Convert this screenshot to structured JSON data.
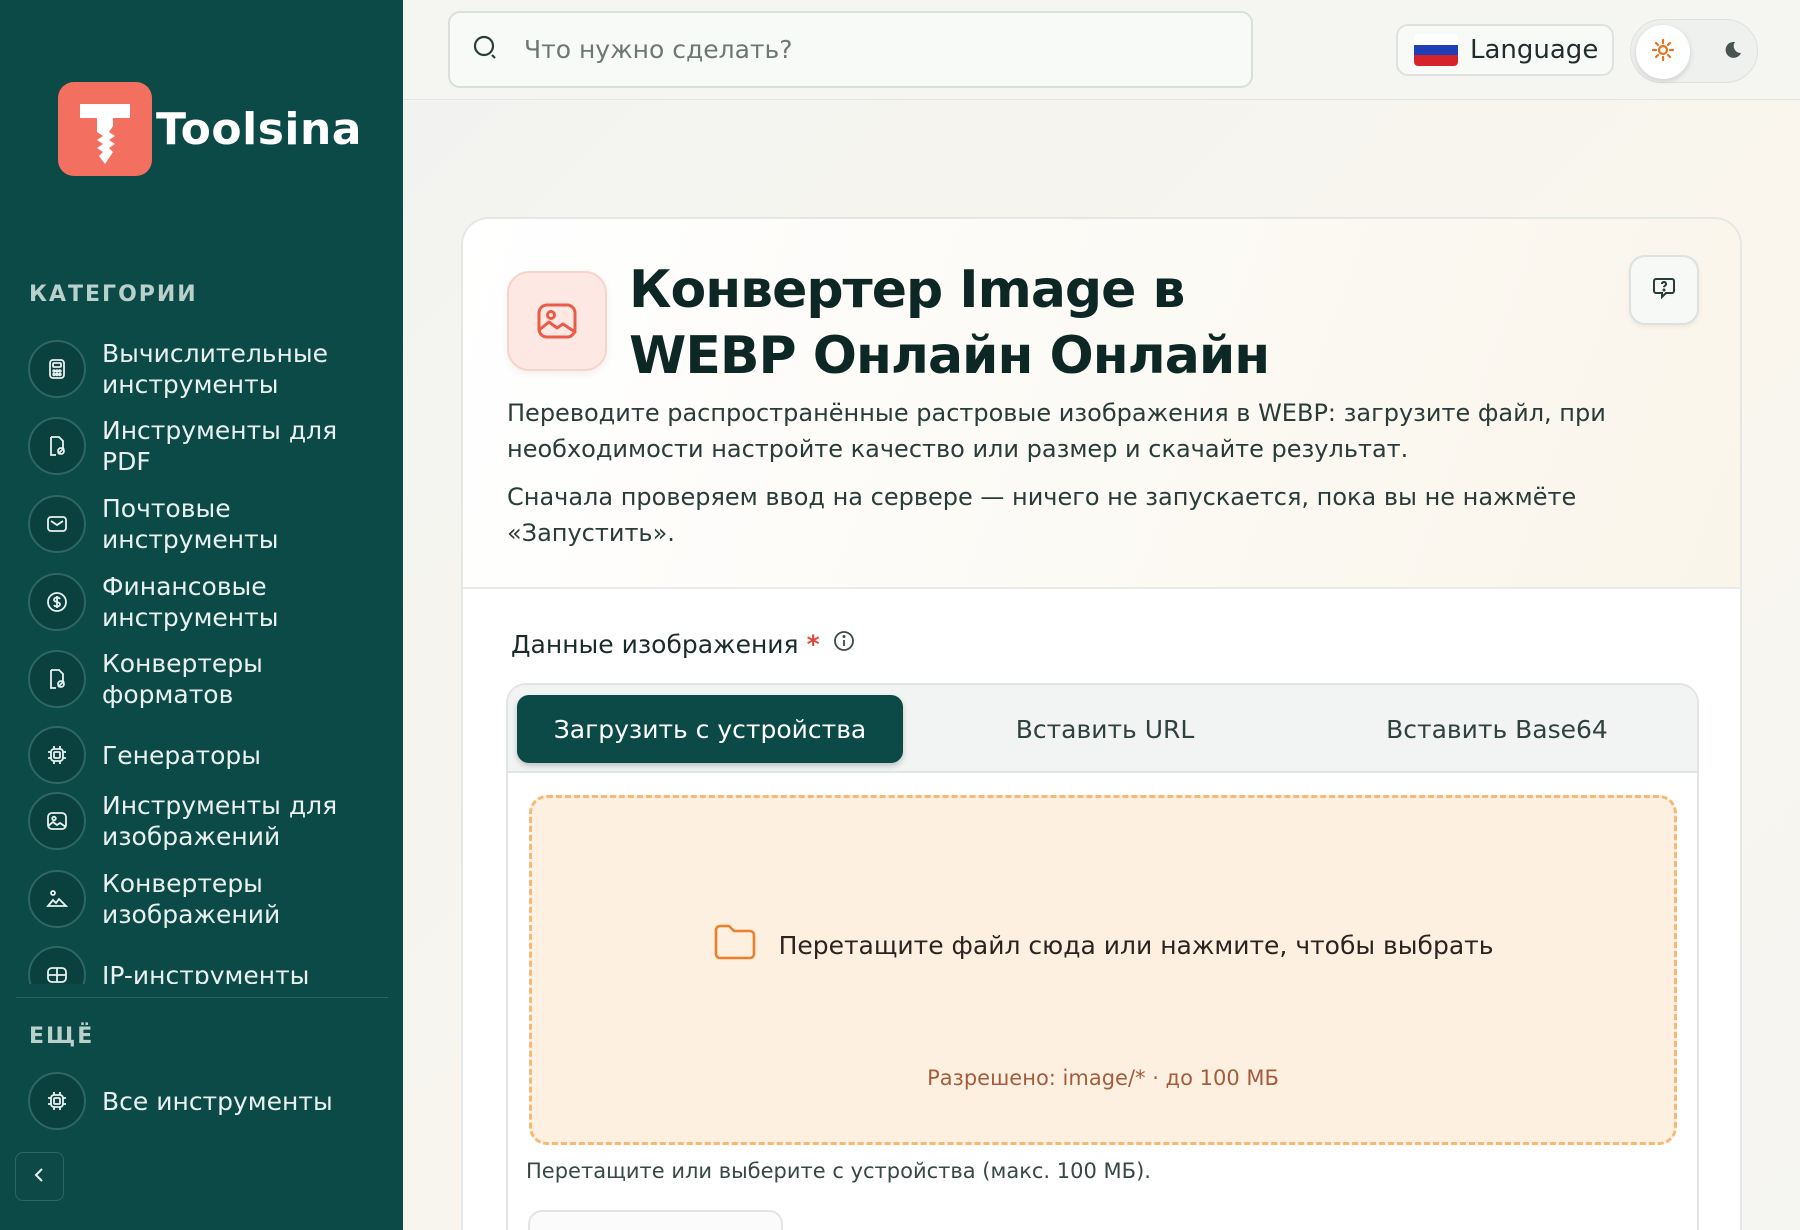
{
  "brand": {
    "name": "Toolsina",
    "logo_color": "#f36f5f",
    "sidebar_color": "#0c4a47"
  },
  "sidebar": {
    "categories_title": "КАТЕГОРИИ",
    "items": [
      {
        "label": "Вычислительные инструменты",
        "icon": "calculator-icon"
      },
      {
        "label": "Инструменты для PDF",
        "icon": "pdf-file-icon"
      },
      {
        "label": "Почтовые инструменты",
        "icon": "mail-icon"
      },
      {
        "label": "Финансовые инструменты",
        "icon": "dollar-icon"
      },
      {
        "label": "Конвертеры форматов",
        "icon": "file-convert-icon"
      },
      {
        "label": "Генераторы",
        "icon": "chip-icon"
      },
      {
        "label": "Инструменты для изображений",
        "icon": "image-icon"
      },
      {
        "label": "Конвертеры изображений",
        "icon": "image-convert-icon"
      },
      {
        "label": "IP-инструменты",
        "icon": "network-icon"
      }
    ],
    "more_title": "ЕЩЁ",
    "more_items": [
      {
        "label": "Все инструменты",
        "icon": "chip-icon"
      }
    ],
    "collapse_icon": "chevron-left-icon"
  },
  "topbar": {
    "search_placeholder": "Что нужно сделать?",
    "language_label": "Language",
    "flag": "russia-flag-icon",
    "theme_light_icon": "sun-icon",
    "theme_dark_icon": "moon-icon"
  },
  "tool": {
    "title_bold_1": "Конвертер",
    "title_regular_1": "Image в",
    "title_regular_2": "WEBP",
    "title_bold_2": "Онлайн Онлайн",
    "description_1": "Переводите распространённые растровые изображения в WEBP: загрузите файл, при необходимости настройте качество или размер и скачайте результат.",
    "description_2": "Сначала проверяем ввод на сервере — ничего не запускается, пока вы не нажмёте «Запустить».",
    "icon": "image-icon",
    "help_icon": "help-chat-icon"
  },
  "form": {
    "field_label": "Данные изображения",
    "required_mark": "*",
    "tabs": [
      "Загрузить с устройства",
      "Вставить URL",
      "Вставить Base64"
    ],
    "active_tab": 0,
    "dropzone_text": "Перетащите файл сюда или нажмите, чтобы выбрать",
    "dropzone_allowed": "Разрешено: image/* · до 100 МБ",
    "hint": "Перетащите или выберите с устройства (макс. 100 МБ)."
  }
}
